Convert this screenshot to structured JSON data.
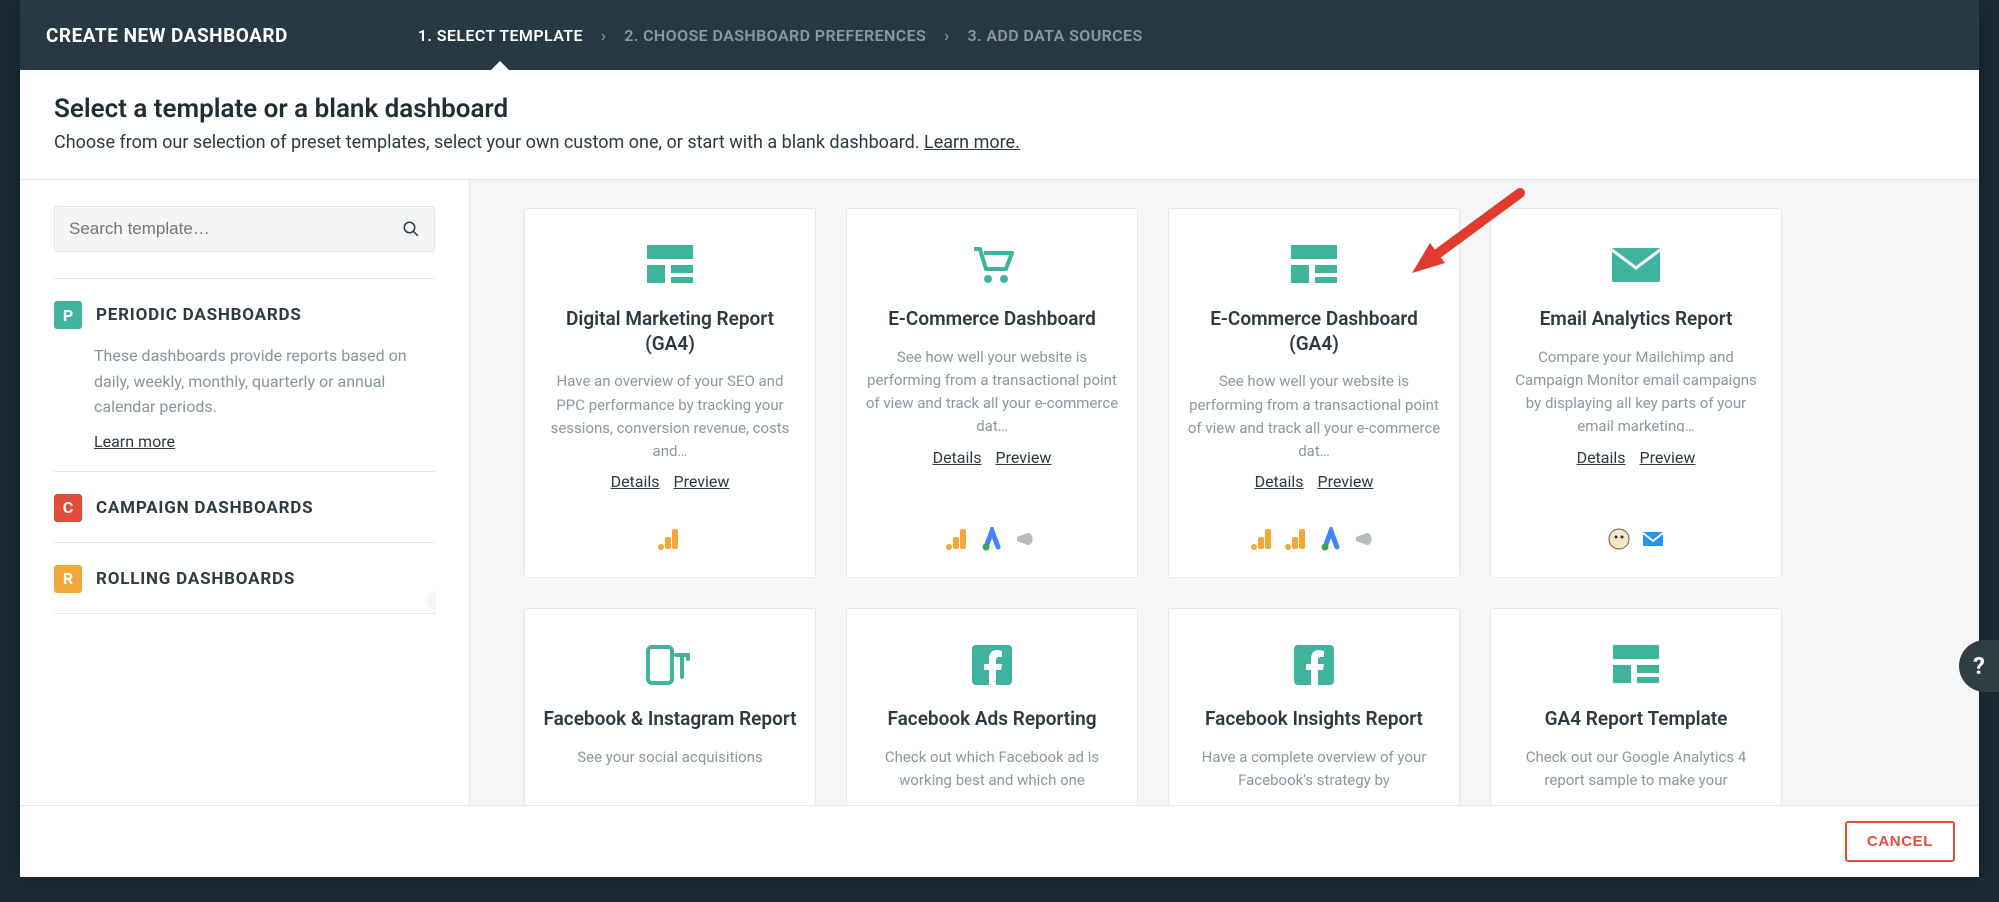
{
  "topbar": {
    "title": "CREATE NEW DASHBOARD",
    "steps": [
      "1. SELECT TEMPLATE",
      "2. CHOOSE DASHBOARD PREFERENCES",
      "3. ADD DATA SOURCES"
    ],
    "active_step": 0
  },
  "header": {
    "heading": "Select a template or a blank dashboard",
    "sub_pre": "Choose from our selection of preset templates, select your own custom one, or start with a blank dashboard. ",
    "learn_more": "Learn more."
  },
  "search": {
    "placeholder": "Search template…"
  },
  "categories": [
    {
      "key": "periodic",
      "badge": "P",
      "badge_color": "p",
      "title": "PERIODIC DASHBOARDS",
      "desc": "These dashboards provide reports based on daily, weekly, monthly, quarterly or annual calendar periods.",
      "learn_more": "Learn more",
      "expanded": true
    },
    {
      "key": "campaign",
      "badge": "C",
      "badge_color": "c",
      "title": "CAMPAIGN DASHBOARDS",
      "expanded": false
    },
    {
      "key": "rolling",
      "badge": "R",
      "badge_color": "r",
      "title": "ROLLING DASHBOARDS",
      "expanded": false
    }
  ],
  "templates": [
    {
      "icon": "dashboard",
      "title": "Digital Marketing Report (GA4)",
      "desc": "Have an overview of your SEO and PPC performance by tracking your sessions, conversion revenue, costs and…",
      "details": "Details",
      "preview": "Preview",
      "sources": [
        "ga"
      ]
    },
    {
      "icon": "cart",
      "title": "E-Commerce Dashboard",
      "desc": "See how well your website is performing from a transactional point of view and track all your e-commerce dat…",
      "details": "Details",
      "preview": "Preview",
      "sources": [
        "ga",
        "gads",
        "bull"
      ]
    },
    {
      "icon": "dashboard",
      "title": "E-Commerce Dashboard (GA4)",
      "desc": "See how well your website is performing from a transactional point of view and track all your e-commerce dat…",
      "details": "Details",
      "preview": "Preview",
      "sources": [
        "ga",
        "ga",
        "gads",
        "bull"
      ]
    },
    {
      "icon": "mail",
      "title": "Email Analytics Report",
      "desc": "Compare your Mailchimp and Campaign Monitor email campaigns by displaying all key parts of your email marketing…",
      "details": "Details",
      "preview": "Preview",
      "sources": [
        "mc",
        "cm"
      ]
    },
    {
      "icon": "cf",
      "title": "Facebook & Instagram Report",
      "desc": "See your social acquisitions",
      "short": true
    },
    {
      "icon": "fb",
      "title": "Facebook Ads Reporting",
      "desc": "Check out which Facebook ad is working best and which one",
      "short": true
    },
    {
      "icon": "fb",
      "title": "Facebook Insights Report",
      "desc": "Have a complete overview of your Facebook's strategy by",
      "short": true
    },
    {
      "icon": "dashboard",
      "title": "GA4 Report Template",
      "desc": "Check out our Google Analytics 4 report sample to make your",
      "short": true
    }
  ],
  "footer": {
    "cancel": "CANCEL"
  },
  "help": "?"
}
